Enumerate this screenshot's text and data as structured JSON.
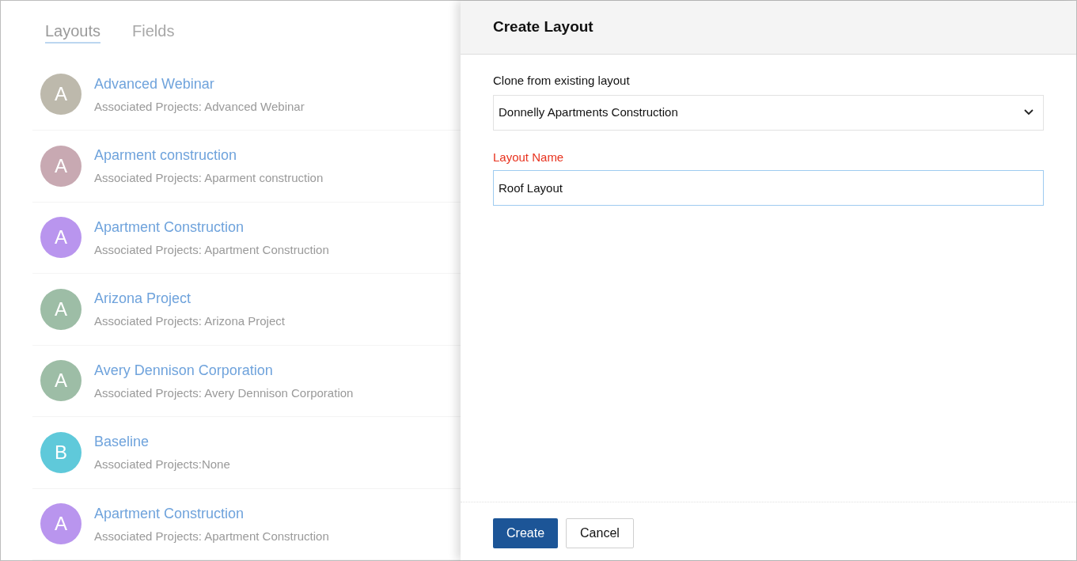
{
  "tabs": [
    {
      "label": "Layouts",
      "selected": true
    },
    {
      "label": "Fields",
      "selected": false
    }
  ],
  "layouts": [
    {
      "initial": "A",
      "color": "#bdb9ac",
      "name": "Advanced Webinar",
      "projects": "Associated Projects: Advanced Webinar"
    },
    {
      "initial": "A",
      "color": "#c8a9b2",
      "name": "Aparment construction",
      "projects": "Associated Projects: Aparment construction"
    },
    {
      "initial": "A",
      "color": "#b995ee",
      "name": "Apartment Construction",
      "projects": "Associated Projects: Apartment Construction"
    },
    {
      "initial": "A",
      "color": "#9dbda6",
      "name": "Arizona Project",
      "projects": "Associated Projects: Arizona Project"
    },
    {
      "initial": "A",
      "color": "#9dbda6",
      "name": "Avery Dennison Corporation",
      "projects": "Associated Projects: Avery Dennison Corporation"
    },
    {
      "initial": "B",
      "color": "#5fc9da",
      "name": "Baseline",
      "projects": "Associated Projects:None"
    },
    {
      "initial": "A",
      "color": "#b995ee",
      "name": "Apartment Construction",
      "projects": "Associated Projects: Apartment Construction"
    }
  ],
  "panel": {
    "title": "Create Layout",
    "clone_label": "Clone from existing layout",
    "clone_value": "Donnelly Apartments Construction",
    "name_label": "Layout Name",
    "name_value": "Roof Layout",
    "buttons": [
      {
        "label": "Create",
        "kind": "primary"
      },
      {
        "label": "Cancel",
        "kind": "secondary"
      }
    ]
  }
}
